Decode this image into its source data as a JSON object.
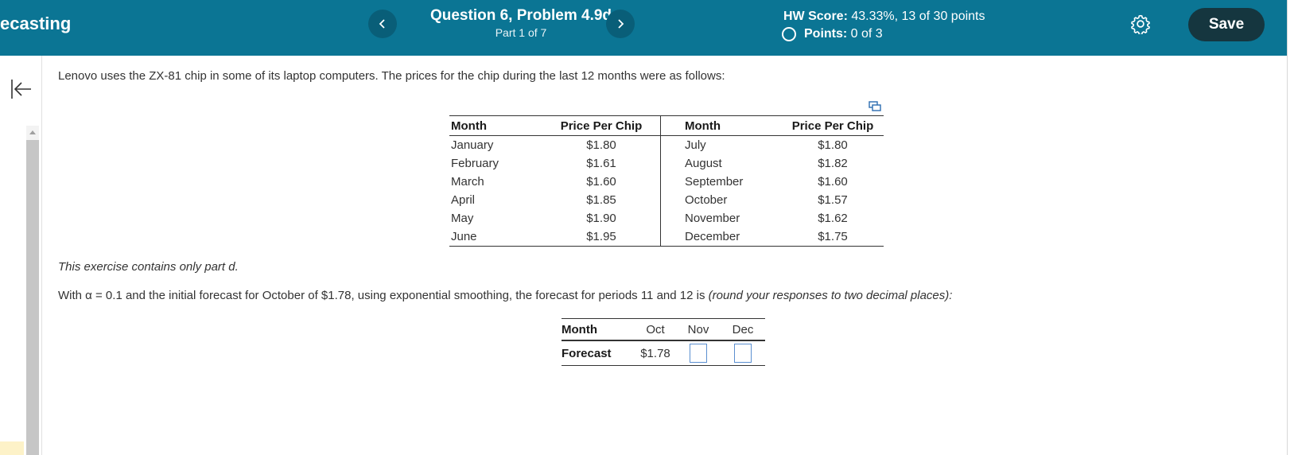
{
  "header": {
    "course_title": "ecasting",
    "question_title": "Question 6, Problem 4.9d",
    "part": "Part 1 of 7",
    "hw_score_label": "HW Score:",
    "hw_score_value": "43.33%, 13 of 30 points",
    "points_label": "Points:",
    "points_value": "0 of 3",
    "save_label": "Save",
    "colors": {
      "bar": "#0b7594",
      "save": "#15363f"
    }
  },
  "problem": {
    "intro": "Lenovo uses the ZX-81 chip in some of its laptop computers.  The prices for the chip during the last 12 months were as follows:",
    "table_headers": {
      "month": "Month",
      "price": "Price Per Chip"
    },
    "rows": [
      {
        "month1": "January",
        "price1": "$1.80",
        "month2": "July",
        "price2": "$1.80"
      },
      {
        "month1": "February",
        "price1": "$1.61",
        "month2": "August",
        "price2": "$1.82"
      },
      {
        "month1": "March",
        "price1": "$1.60",
        "month2": "September",
        "price2": "$1.60"
      },
      {
        "month1": "April",
        "price1": "$1.85",
        "month2": "October",
        "price2": "$1.57"
      },
      {
        "month1": "May",
        "price1": "$1.90",
        "month2": "November",
        "price2": "$1.62"
      },
      {
        "month1": "June",
        "price1": "$1.95",
        "month2": "December",
        "price2": "$1.75"
      }
    ],
    "exercise_note": "This exercise contains only part d.",
    "question_main": "With α = 0.1 and the initial forecast for October of $1.78, using exponential smoothing, the forecast for periods 11 and 12 is ",
    "question_hint": "(round your responses to two decimal places):"
  },
  "forecast": {
    "month_label": "Month",
    "forecast_label": "Forecast",
    "months": [
      "Oct",
      "Nov",
      "Dec"
    ],
    "oct_value": "$1.78",
    "nov_value": "",
    "dec_value": ""
  }
}
